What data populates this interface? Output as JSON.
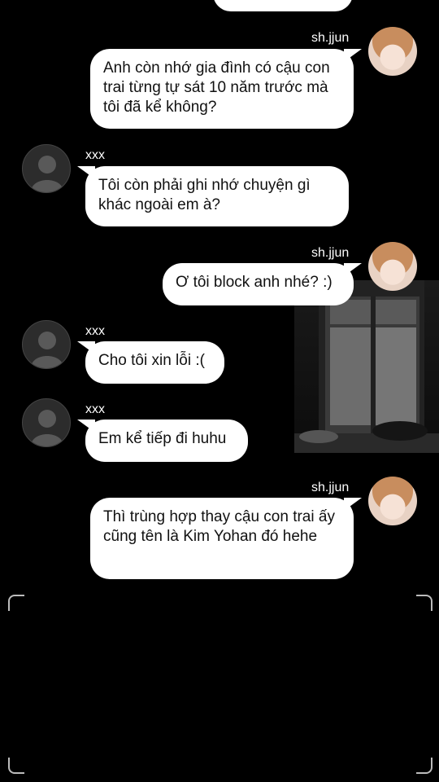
{
  "messages": [
    {
      "sender": "sh.jjun",
      "side": "right",
      "text": "Anh còn nhớ gia đình có cậu con trai từng tự sát 10 năm trước mà tôi đã kể không?"
    },
    {
      "sender": "xxx",
      "side": "left",
      "text": "Tôi còn phải ghi nhớ chuyện gì khác ngoài em à?"
    },
    {
      "sender": "sh.jjun",
      "side": "right",
      "text": "Ơ tôi block anh nhé? :)"
    },
    {
      "sender": "xxx",
      "side": "left",
      "text": "Cho tôi xin lỗi :("
    },
    {
      "sender": "xxx",
      "side": "left",
      "text": "Em kể tiếp đi huhu"
    },
    {
      "sender": "sh.jjun",
      "side": "right",
      "text": "Thì trùng hợp thay cậu con trai ấy cũng tên là Kim Yohan đó hehe"
    }
  ]
}
